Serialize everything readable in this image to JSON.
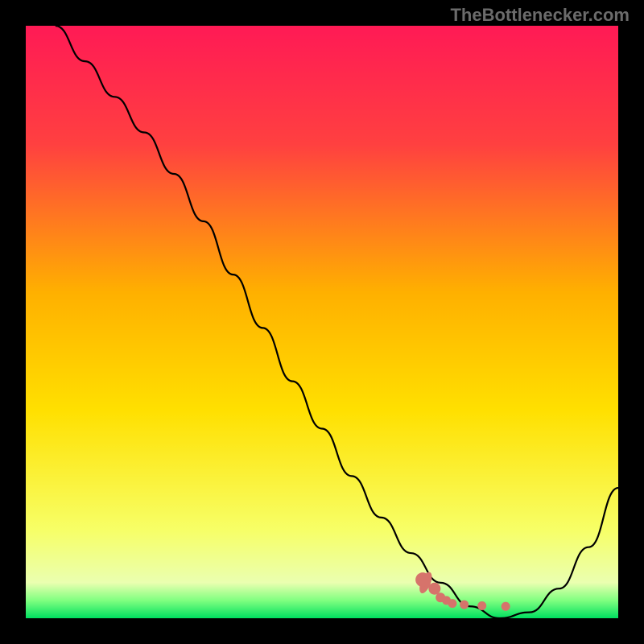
{
  "watermark": "TheBottlenecker.com",
  "chart_data": {
    "type": "line",
    "title": "",
    "xlabel": "",
    "ylabel": "",
    "xlim": [
      0,
      100
    ],
    "ylim": [
      0,
      100
    ],
    "series": [
      {
        "name": "curve",
        "x": [
          5,
          10,
          15,
          20,
          25,
          30,
          35,
          40,
          45,
          50,
          55,
          60,
          65,
          70,
          75,
          80,
          85,
          90,
          95,
          100
        ],
        "y": [
          100,
          94,
          88,
          82,
          75,
          67,
          58,
          49,
          40,
          32,
          24,
          17,
          11,
          6,
          2,
          0,
          1,
          5,
          12,
          22
        ],
        "note": "y is estimated % height; minimum around x≈80"
      }
    ],
    "markers": {
      "name": "highlight-dots",
      "x": [
        67,
        69,
        70,
        71,
        72,
        74,
        77,
        81
      ],
      "y": [
        6.5,
        5.0,
        3.5,
        3.0,
        2.5,
        2.3,
        2.1,
        2.0
      ],
      "color": "#d6736b"
    },
    "background_gradient": {
      "stops": [
        {
          "pos": 0.0,
          "color": "#ff1a55"
        },
        {
          "pos": 0.2,
          "color": "#ff4040"
        },
        {
          "pos": 0.45,
          "color": "#ffb000"
        },
        {
          "pos": 0.65,
          "color": "#ffe000"
        },
        {
          "pos": 0.85,
          "color": "#f7ff66"
        },
        {
          "pos": 0.94,
          "color": "#eaffb0"
        },
        {
          "pos": 0.97,
          "color": "#80ff80"
        },
        {
          "pos": 1.0,
          "color": "#00e060"
        }
      ]
    }
  }
}
